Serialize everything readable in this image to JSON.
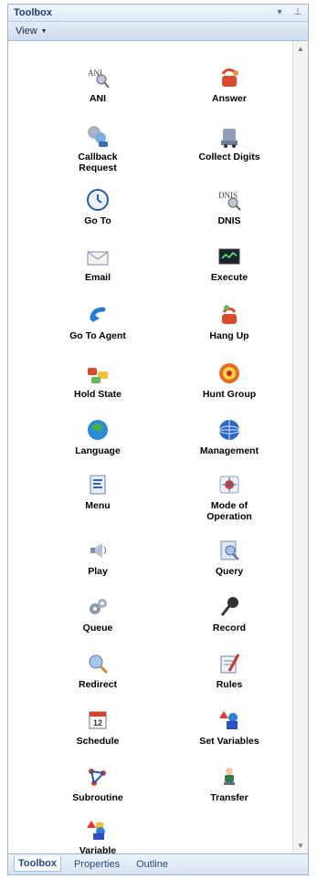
{
  "window": {
    "title": "Toolbox"
  },
  "toolbar": {
    "view_label": "View",
    "view_arrow": "▼"
  },
  "title_buttons": {
    "dropdown": "▾",
    "pin": "⊥"
  },
  "items": [
    {
      "label": "ANI",
      "icon": "ani-icon"
    },
    {
      "label": "Answer",
      "icon": "answer-icon"
    },
    {
      "label": "Callback\nRequest",
      "icon": "callback-request-icon"
    },
    {
      "label": "Collect Digits",
      "icon": "collect-digits-icon"
    },
    {
      "label": "Go To",
      "icon": "clock-icon"
    },
    {
      "label": "DNIS",
      "icon": "dnis-icon"
    },
    {
      "label": "Email",
      "icon": "email-icon"
    },
    {
      "label": "Execute",
      "icon": "execute-icon"
    },
    {
      "label": "Go To Agent",
      "icon": "goto-agent-icon"
    },
    {
      "label": "Hang Up",
      "icon": "hang-up-icon"
    },
    {
      "label": "Hold State",
      "icon": "hold-state-icon"
    },
    {
      "label": "Hunt Group",
      "icon": "hunt-group-icon"
    },
    {
      "label": "Language",
      "icon": "globe-icon"
    },
    {
      "label": "Management",
      "icon": "management-icon"
    },
    {
      "label": "Menu",
      "icon": "menu-icon"
    },
    {
      "label": "Mode of\nOperation",
      "icon": "mode-of-operation-icon"
    },
    {
      "label": "Play",
      "icon": "play-icon"
    },
    {
      "label": "Query",
      "icon": "query-icon"
    },
    {
      "label": "Queue",
      "icon": "queue-icon"
    },
    {
      "label": "Record",
      "icon": "microphone-icon"
    },
    {
      "label": "Redirect",
      "icon": "redirect-icon"
    },
    {
      "label": "Rules",
      "icon": "rules-icon"
    },
    {
      "label": "Schedule",
      "icon": "calendar-icon"
    },
    {
      "label": "Set Variables",
      "icon": "set-variables-icon"
    },
    {
      "label": "Subroutine",
      "icon": "subroutine-icon"
    },
    {
      "label": "Transfer",
      "icon": "transfer-icon"
    },
    {
      "label": "Variable\nCompare",
      "icon": "variable-compare-icon"
    }
  ],
  "footer_tabs": [
    "Toolbox",
    "Properties",
    "Outline"
  ],
  "icon_glyphs": {
    "ani_text": "ANI",
    "dnis_text": "DNIS",
    "calendar_day": "12",
    "scroll_up": "▲",
    "scroll_down": "▼"
  }
}
